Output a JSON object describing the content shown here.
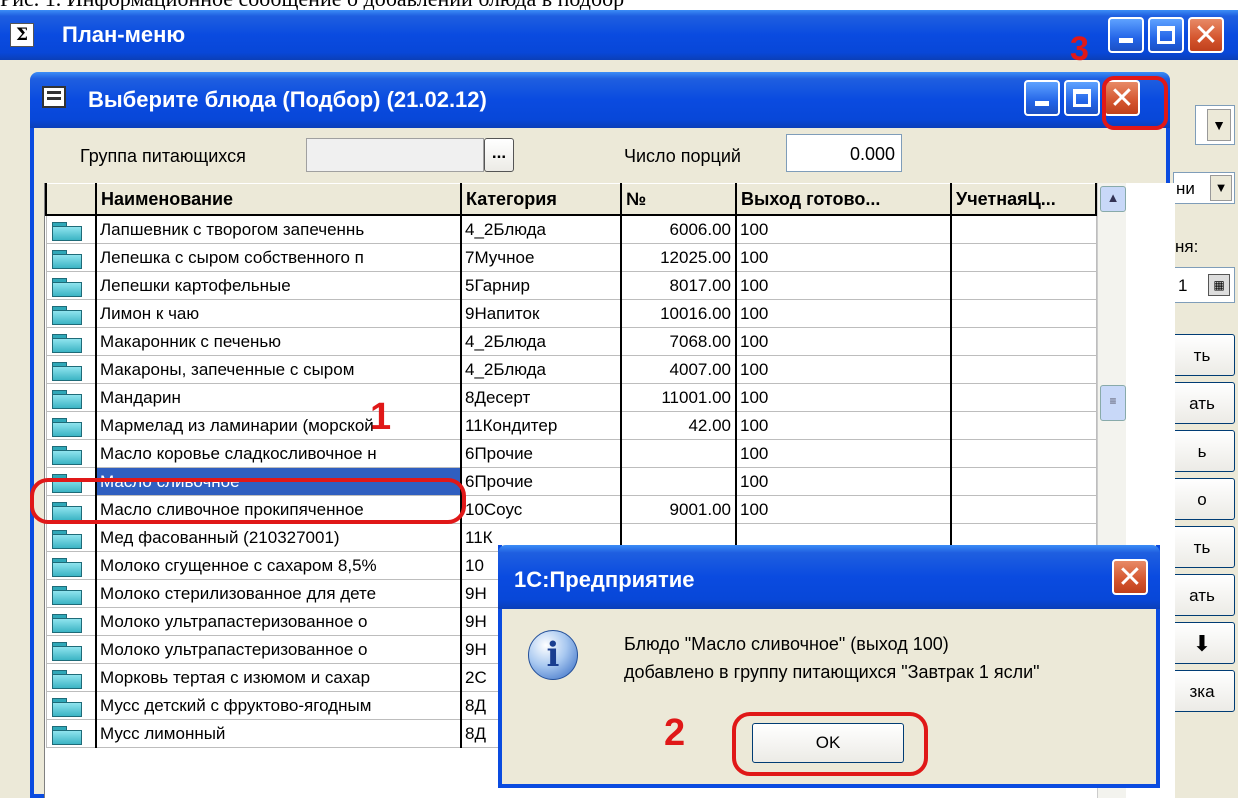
{
  "top_cut_text": "Рис. 1. Информационное сообщение о добавлении блюда в подбор",
  "outer_window": {
    "title": "План-меню",
    "app_icon": "sigma-icon",
    "right_panel": [
      "ни",
      "ня:",
      "1",
      "ть",
      "ать",
      "ь",
      "о",
      "ть",
      "ать",
      "зка"
    ]
  },
  "inner_window": {
    "title": "Выберите блюда (Подбор) (21.02.12)",
    "icon": "form-icon",
    "group_label": "Группа питающихся",
    "group_value": "",
    "portions_label": "Число порций",
    "portions_value": "0.000",
    "columns": [
      "Наименование",
      "Категория",
      "№",
      "Выход готово...",
      "УчетнаяЦ..."
    ],
    "rows": [
      {
        "name": "Лапшевник с творогом запеченнь",
        "cat": "4_2Блюда",
        "num": "6006.00",
        "out": "100"
      },
      {
        "name": "Лепешка с сыром собственного п",
        "cat": "7Мучное",
        "num": "12025.00",
        "out": "100"
      },
      {
        "name": "Лепешки картофельные",
        "cat": "5Гарнир",
        "num": "8017.00",
        "out": "100"
      },
      {
        "name": "Лимон к чаю",
        "cat": "9Напиток",
        "num": "10016.00",
        "out": "100"
      },
      {
        "name": "Макаронник с печенью",
        "cat": "4_2Блюда",
        "num": "7068.00",
        "out": "100"
      },
      {
        "name": "Макароны, запеченные с сыром",
        "cat": "4_2Блюда",
        "num": "4007.00",
        "out": "100"
      },
      {
        "name": "Мандарин",
        "cat": "8Десерт",
        "num": "11001.00",
        "out": "100"
      },
      {
        "name": "Мармелад из ламинарии (морской",
        "cat": "11Кондитер",
        "num": "42.00",
        "out": "100"
      },
      {
        "name": "Масло коровье сладкосливочное н",
        "cat": "6Прочие",
        "num": "",
        "out": "100"
      },
      {
        "name": "Масло сливочное",
        "cat": "6Прочие",
        "num": "",
        "out": "100"
      },
      {
        "name": "Масло сливочное прокипяченное",
        "cat": "10Соус",
        "num": "9001.00",
        "out": "100"
      },
      {
        "name": "Мед фасованный (210327001)",
        "cat": "11К",
        "num": "",
        "out": ""
      },
      {
        "name": "Молоко сгущенное с сахаром 8,5%",
        "cat": "10",
        "num": "",
        "out": ""
      },
      {
        "name": "Молоко стерилизованное для дете",
        "cat": "9Н",
        "num": "",
        "out": ""
      },
      {
        "name": "Молоко ультрапастеризованное о",
        "cat": "9Н",
        "num": "",
        "out": ""
      },
      {
        "name": "Молоко ультрапастеризованное о",
        "cat": "9Н",
        "num": "",
        "out": ""
      },
      {
        "name": "Морковь тертая с изюмом и сахар",
        "cat": "2С",
        "num": "",
        "out": ""
      },
      {
        "name": "Мусс детский с фруктово-ягодным",
        "cat": "8Д",
        "num": "",
        "out": ""
      },
      {
        "name": "Мусс лимонный",
        "cat": "8Д",
        "num": "",
        "out": ""
      }
    ],
    "selected_row": 9
  },
  "dialog": {
    "title": "1С:Предприятие",
    "message_line1": "Блюдо \"Масло сливочное\" (выход 100)",
    "message_line2": "добавлено в группу питающихся \"Завтрак 1 ясли\"",
    "ok_label": "OK",
    "icon": "info-icon"
  },
  "annotations": {
    "n1": "1",
    "n2": "2",
    "n3": "3",
    "color": "#e01818"
  }
}
